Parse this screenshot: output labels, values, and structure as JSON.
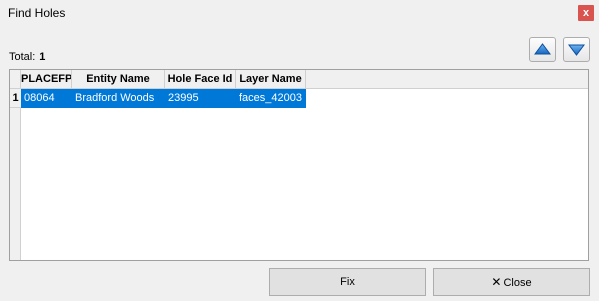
{
  "window": {
    "title": "Find Holes",
    "close_glyph": "x"
  },
  "summary": {
    "total_label": "Total:",
    "total_value": "1"
  },
  "nav": {
    "up_icon": "arrow-up-icon",
    "down_icon": "arrow-down-icon",
    "accent": "#1c7fd6"
  },
  "table": {
    "columns": [
      "PLACEFP",
      "Entity Name",
      "Hole Face Id",
      "Layer Name"
    ],
    "rows": [
      {
        "row_number": "1",
        "cells": [
          "08064",
          "Bradford Woods",
          "23995",
          "faces_42003"
        ]
      }
    ],
    "selection_color": "#0078d7"
  },
  "buttons": {
    "fix_label": "Fix",
    "close_label": "Close",
    "close_icon": "close-icon"
  }
}
